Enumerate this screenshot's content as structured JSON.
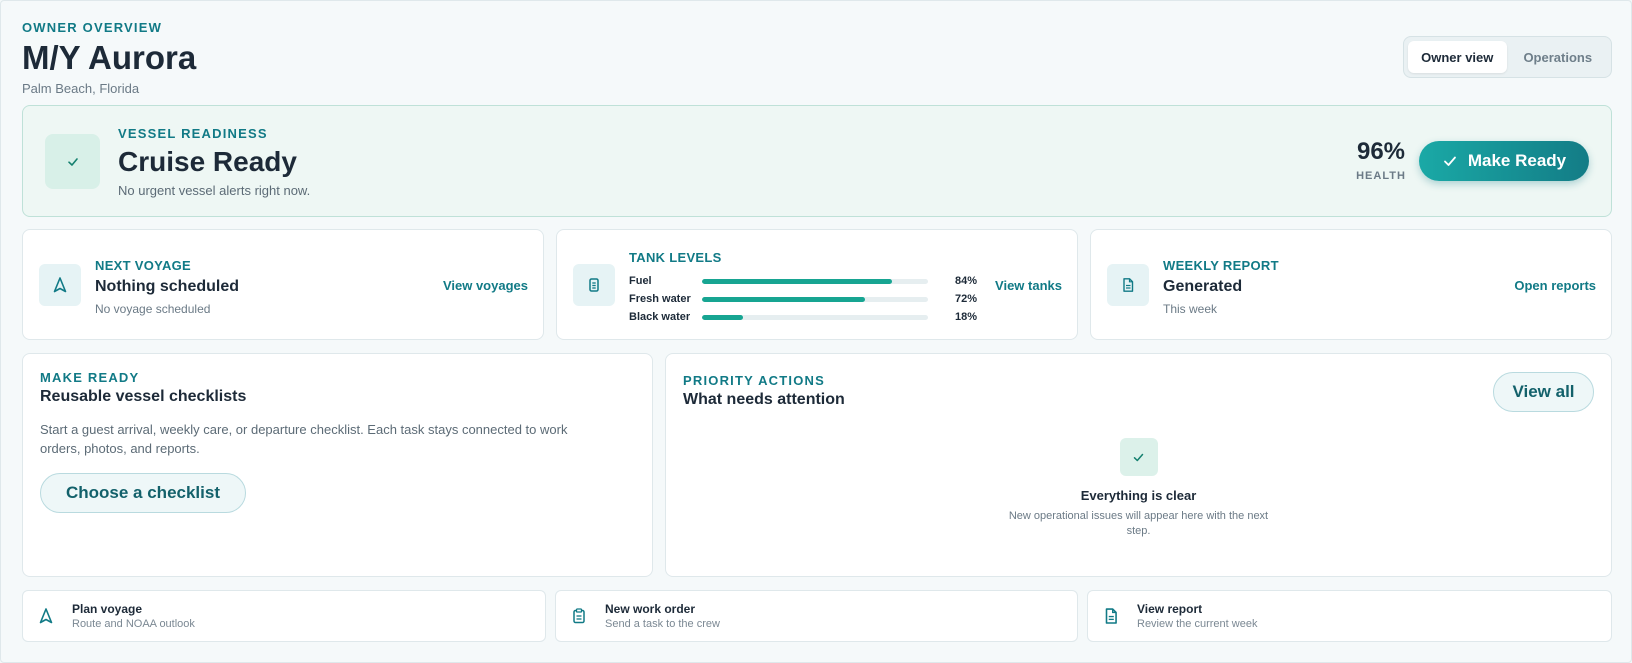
{
  "header": {
    "eyebrow": "OWNER OVERVIEW",
    "title": "M/Y Aurora",
    "location": "Palm Beach, Florida"
  },
  "view_toggle": {
    "options": [
      "Owner view",
      "Operations"
    ],
    "selected": "Owner view"
  },
  "readiness": {
    "label": "VESSEL READINESS",
    "status": "Cruise Ready",
    "message": "No urgent vessel alerts right now.",
    "health_value": "96%",
    "health_label": "HEALTH",
    "button_label": "Make Ready"
  },
  "cards": {
    "voyage": {
      "label": "NEXT VOYAGE",
      "value": "Nothing scheduled",
      "sub": "No voyage scheduled",
      "link": "View voyages"
    },
    "tanks": {
      "label": "TANK LEVELS",
      "link": "View tanks",
      "items": [
        {
          "name": "Fuel",
          "level": 84,
          "label": "84%"
        },
        {
          "name": "Fresh water",
          "level": 72,
          "label": "72%"
        },
        {
          "name": "Black water",
          "level": 18,
          "label": "18%"
        }
      ]
    },
    "report": {
      "label": "WEEKLY REPORT",
      "value": "Generated",
      "sub": "This week",
      "link": "Open reports"
    }
  },
  "make_ready": {
    "label": "MAKE READY",
    "title": "Reusable vessel checklists",
    "description": "Start a guest arrival, weekly care, or departure checklist. Each task stays connected to work orders, photos, and reports.",
    "button_label": "Choose a checklist"
  },
  "priority": {
    "label": "PRIORITY ACTIONS",
    "title": "What needs attention",
    "button_label": "View all",
    "empty_title": "Everything is clear",
    "empty_sub": "New operational issues will appear here with the next step."
  },
  "quick_actions": [
    {
      "icon": "navigation-icon",
      "title": "Plan voyage",
      "sub": "Route and NOAA outlook"
    },
    {
      "icon": "clipboard-icon",
      "title": "New work order",
      "sub": "Send a task to the crew"
    },
    {
      "icon": "document-icon",
      "title": "View report",
      "sub": "Review the current week"
    }
  ],
  "colors": {
    "accent": "#117a86",
    "primary_button": "#1aa9a6",
    "success": "#15806f",
    "tank_fill": "#17a592"
  }
}
